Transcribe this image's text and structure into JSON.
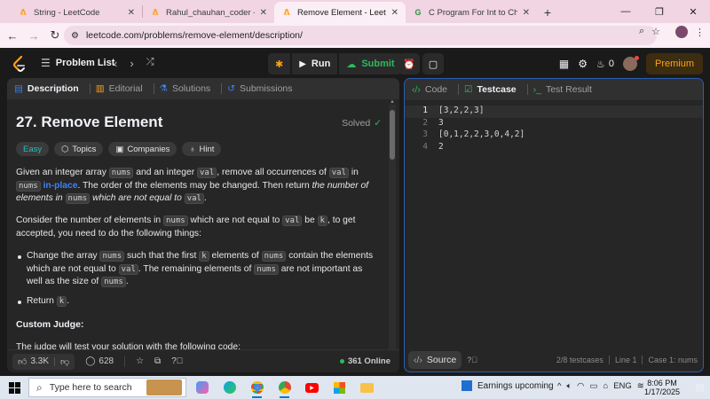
{
  "browser": {
    "tabs": [
      {
        "title": "String - LeetCode",
        "close": "✕",
        "active": false
      },
      {
        "title": "Rahul_chauhan_coder - LeetCode",
        "close": "✕",
        "active": false
      },
      {
        "title": "Remove Element - LeetCode",
        "close": "✕",
        "active": true
      },
      {
        "title": "C Program For Int to Char Conversion",
        "close": "✕",
        "active": false
      }
    ],
    "url": "leetcode.com/problems/remove-element/description/"
  },
  "nav": {
    "problem_list": "Problem List",
    "run": "Run",
    "submit": "Submit",
    "streak": "0",
    "premium": "Premium"
  },
  "left_tabs": [
    {
      "label": "Description"
    },
    {
      "label": "Editorial"
    },
    {
      "label": "Solutions"
    },
    {
      "label": "Submissions"
    }
  ],
  "problem": {
    "title": "27. Remove Element",
    "solved": "Solved",
    "tags": [
      "Easy",
      "Topics",
      "Companies",
      "Hint"
    ],
    "p1": {
      "a": "Given an integer array ",
      "nums": "nums",
      "b": " and an integer ",
      "val": "val",
      "c": ", remove all occurrences of ",
      "d": " in ",
      "inplace": "in-place",
      "e": ". The order of the elements may be changed. Then return ",
      "f": "the number of elements in",
      "g": "which are not equal to",
      "h": "."
    },
    "p2": {
      "a": "Consider the number of elements in ",
      "nums": "nums",
      "b": " which are not equal to ",
      "val": "val",
      "c": " be ",
      "k": "k",
      "d": ", to get accepted, you need to do the following things:"
    },
    "b1": {
      "a": "Change the array ",
      "nums": "nums",
      "b": " such that the first ",
      "k": "k",
      "c": " elements of ",
      "d": " contain the elements which are not equal to ",
      "val": "val",
      "e": ". The remaining elements of ",
      "f": " are not important as well as the size of ",
      "g": "."
    },
    "b2": {
      "a": "Return ",
      "k": "k",
      "b": "."
    },
    "custom_judge": "Custom Judge:",
    "judge_text": "The judge will test your solution with the following code:"
  },
  "footer": {
    "likes": "3.3K",
    "comments": "628",
    "online": "361 Online"
  },
  "right_tabs": [
    {
      "label": "Code"
    },
    {
      "label": "Testcase"
    },
    {
      "label": "Test Result"
    }
  ],
  "editor_lines": [
    {
      "n": "1",
      "text": "[3,2,2,3]"
    },
    {
      "n": "2",
      "text": "3"
    },
    {
      "n": "3",
      "text": "[0,1,2,2,3,0,4,2]"
    },
    {
      "n": "4",
      "text": "2"
    }
  ],
  "right_footer": {
    "source": "Source",
    "testcases": "2/8 testcases",
    "line": "Line 1",
    "case": "Case 1: nums"
  },
  "taskbar": {
    "search": "Type here to search",
    "weather": "Earnings upcoming",
    "lang": "ENG",
    "time": "8:06 PM",
    "date": "1/17/2025"
  },
  "colors": {
    "accent": "#ffa116",
    "green": "#2cbb5d",
    "blue": "#3b82f6"
  }
}
